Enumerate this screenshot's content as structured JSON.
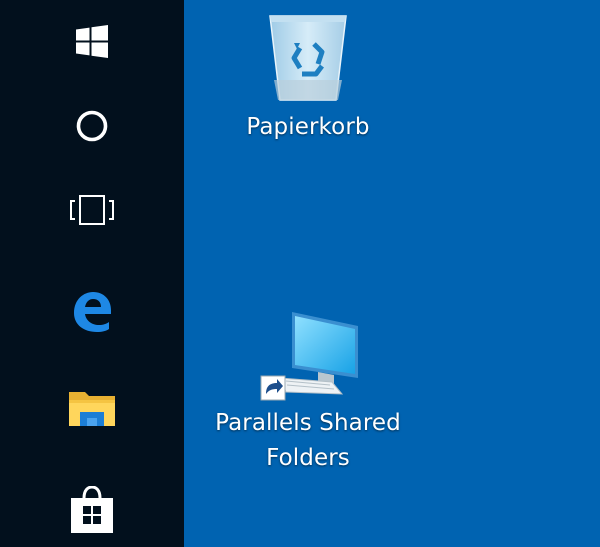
{
  "colors": {
    "desktop_background": "#0063b1",
    "taskbar_background": "#02101d",
    "label_text": "#ffffff"
  },
  "taskbar": {
    "buttons": [
      {
        "name": "start",
        "icon": "windows-logo-icon"
      },
      {
        "name": "cortana",
        "icon": "cortana-ring-icon"
      },
      {
        "name": "task-view",
        "icon": "task-view-icon"
      },
      {
        "name": "edge",
        "icon": "edge-browser-icon"
      },
      {
        "name": "file-explorer",
        "icon": "folder-icon"
      },
      {
        "name": "store",
        "icon": "store-bag-icon"
      }
    ]
  },
  "desktop": {
    "icons": [
      {
        "label": "Papierkorb",
        "icon": "recycle-bin-icon"
      },
      {
        "label_line1": "Parallels Shared",
        "label_line2": "Folders",
        "icon": "computer-shortcut-icon"
      }
    ]
  }
}
